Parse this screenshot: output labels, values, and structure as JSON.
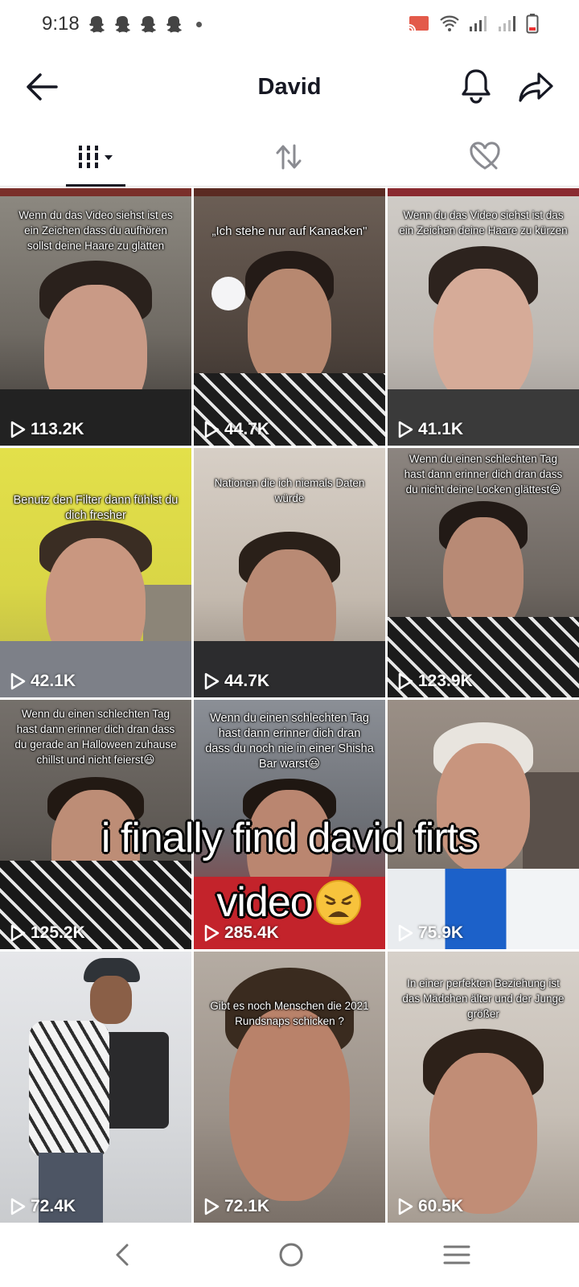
{
  "status_bar": {
    "time": "9:18"
  },
  "header": {
    "title": "David"
  },
  "tabs": [
    {
      "name": "videos"
    },
    {
      "name": "reposts"
    },
    {
      "name": "liked"
    }
  ],
  "videos": [
    {
      "text": "Wenn du das Video siehst ist es ein Zeichen dass du aufhören sollst deine Haare zu glätten",
      "views": "113.2K"
    },
    {
      "text": "„Ich stehe nur auf Kanacken\"",
      "views": "44.7K"
    },
    {
      "text": "Wenn du das Video siehst ist das ein Zeichen deine Haare zu kürzen",
      "views": "41.1K"
    },
    {
      "text": "Benutz den Filter dann fühlst du dich fresher",
      "views": "42.1K"
    },
    {
      "text": "Nationen die ich niemals Daten würde",
      "views": "44.7K"
    },
    {
      "text": "Wenn du einen schlechten Tag hast dann erinner dich dran dass du nicht deine Locken glättest😃",
      "views": "123.9K"
    },
    {
      "text": "Wenn du einen schlechten Tag hast dann erinner dich dran dass du gerade an Halloween zuhause chillst und nicht feierst😃",
      "views": "125.2K"
    },
    {
      "text": "Wenn du einen schlechten Tag hast dann erinner dich dran dass du noch nie in einer Shisha Bar warst😃",
      "views": "285.4K"
    },
    {
      "text": "",
      "views": "75.9K"
    },
    {
      "text": "",
      "views": "72.4K"
    },
    {
      "text": "Gibt es noch Menschen die 2021 Rundsnaps schicken ?",
      "views": "72.1K"
    },
    {
      "text": "In einer perfekten Beziehung ist das Mädchen älter und der Junge größer",
      "views": "60.5K"
    }
  ],
  "caption": {
    "line1": "i finally find david firts",
    "line2": "video"
  },
  "colors": {
    "text_primary": "#161823",
    "overlay_text": "#ffffff"
  }
}
